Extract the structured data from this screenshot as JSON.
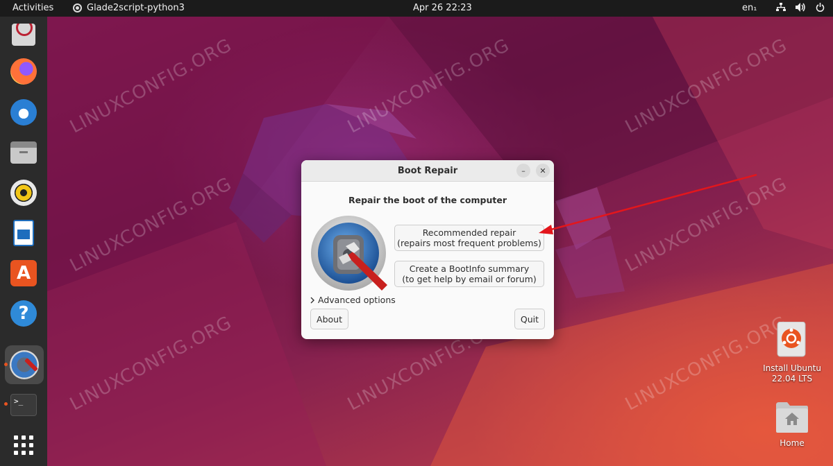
{
  "topbar": {
    "activities": "Activities",
    "app_name": "Glade2script-python3",
    "clock": "Apr 26  22:23",
    "keyboard_layout": "en₁"
  },
  "dock": {
    "items": [
      "startup-disk-icon",
      "firefox-icon",
      "thunderbird-icon",
      "files-icon",
      "rhythmbox-icon",
      "writer-icon",
      "software-center-icon",
      "help-icon",
      "boot-repair-icon",
      "terminal-icon",
      "app-grid-icon"
    ]
  },
  "watermark": "LINUXCONFIG.ORG",
  "dialog": {
    "title": "Boot Repair",
    "minimize_label": "–",
    "close_label": "✕",
    "heading": "Repair the boot of the computer",
    "recommended": {
      "line1": "Recommended repair",
      "line2": "(repairs most frequent problems)"
    },
    "bootinfo": {
      "line1": "Create a BootInfo summary",
      "line2": "(to get help by email or forum)"
    },
    "advanced_label": "Advanced options",
    "about_label": "About",
    "quit_label": "Quit"
  },
  "desktop": {
    "install_label_1": "Install Ubuntu",
    "install_label_2": "22.04 LTS",
    "home_label": "Home"
  },
  "colors": {
    "accent": "#e95420",
    "arrow": "#e3161c",
    "topbar": "#1b1b1b",
    "dock": "#2b2b2b"
  }
}
